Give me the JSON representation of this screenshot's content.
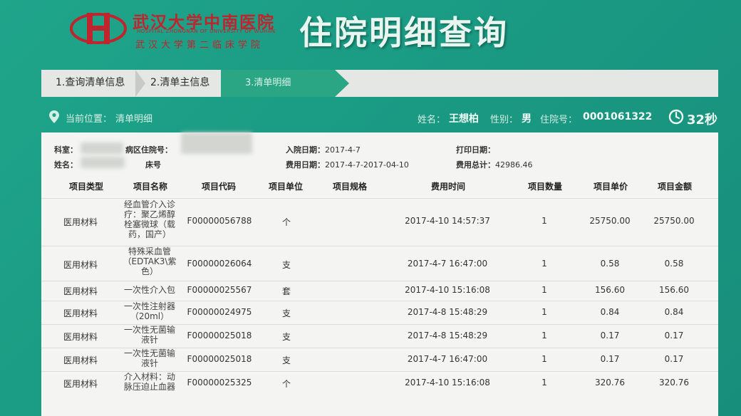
{
  "hospital": {
    "name_cn": "武汉大学中南医院",
    "name_en": "HOSPITAL ZHONGNAN OF UNIVERSITY OF WUHAN",
    "name_cn2": "武汉大学第二临床学院"
  },
  "page_title": "住院明细查询",
  "steps": {
    "s1": "1.查询清单信息",
    "s2": "2.清单主信息",
    "s3": "3.清单明细"
  },
  "location": {
    "label": "当前位置：",
    "value": "清单明细"
  },
  "patient": {
    "name_label": "姓名：",
    "name": "王想柏",
    "gender_label": "性别：",
    "gender": "男",
    "id_label": "住院号：",
    "id": "0001061322"
  },
  "timer": "32秒",
  "info": {
    "dept_label": "科室：",
    "ward_label": "病区住院号：",
    "name_label": "姓名：",
    "bed_label": "床号",
    "admit_label": "入院日期：",
    "admit_value": "2017-4-7",
    "fee_date_label": "费用日期：",
    "fee_date_value": "2017-4-7-2017-04-10",
    "print_label": "打印日期：",
    "total_label": "费用总计：",
    "total_value": "42986.46"
  },
  "columns": [
    "项目类型",
    "项目名称",
    "项目代码",
    "项目单位",
    "项目规格",
    "费用时间",
    "项目数量",
    "项目单价",
    "项目金额"
  ],
  "rows": [
    {
      "type": "医用材料",
      "name": "经血管介入诊疗：聚乙烯醇栓塞微球（载药，国产）",
      "code": "F00000056788",
      "unit": "个",
      "spec": "",
      "time": "2017-4-10 14:57:37",
      "qty": "1",
      "price": "25750.00",
      "amount": "25750.00"
    },
    {
      "type": "医用材料",
      "name": "特殊采血管（EDTAK3\\紫色）",
      "code": "F00000026064",
      "unit": "支",
      "spec": "",
      "time": "2017-4-7 16:47:00",
      "qty": "1",
      "price": "0.58",
      "amount": "0.58"
    },
    {
      "type": "医用材料",
      "name": "一次性介入包",
      "code": "F00000025567",
      "unit": "套",
      "spec": "",
      "time": "2017-4-10 15:16:08",
      "qty": "1",
      "price": "156.60",
      "amount": "156.60"
    },
    {
      "type": "医用材料",
      "name": "一次性注射器（20ml）",
      "code": "F00000024975",
      "unit": "支",
      "spec": "",
      "time": "2017-4-8 15:48:29",
      "qty": "1",
      "price": "0.84",
      "amount": "0.84"
    },
    {
      "type": "医用材料",
      "name": "一次性无菌输液针",
      "code": "F00000025018",
      "unit": "支",
      "spec": "",
      "time": "2017-4-8 15:48:29",
      "qty": "1",
      "price": "0.17",
      "amount": "0.17"
    },
    {
      "type": "医用材料",
      "name": "一次性无菌输液针",
      "code": "F00000025018",
      "unit": "支",
      "spec": "",
      "time": "2017-4-7 16:47:00",
      "qty": "1",
      "price": "0.17",
      "amount": "0.17"
    },
    {
      "type": "医用材料",
      "name": "介入材料：动脉压迫止血器",
      "code": "F00000025325",
      "unit": "个",
      "spec": "",
      "time": "2017-4-10 15:16:08",
      "qty": "1",
      "price": "320.76",
      "amount": "320.76"
    }
  ]
}
